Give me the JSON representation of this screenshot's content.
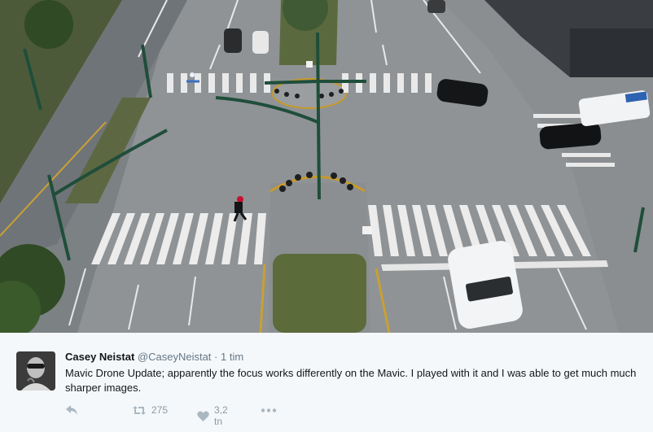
{
  "tweet": {
    "author_name": "Casey Neistat",
    "author_handle": "@CaseyNeistat",
    "separator": "·",
    "time": "1 tim",
    "text": "Mavic Drone Update; apparently the focus works differently on the Mavic.  I played with it and I was able to get much much sharper images.",
    "media_description_icon": "drone-photo-intersection"
  },
  "actions": {
    "reply_icon": "reply-icon",
    "retweet_count": "275",
    "like_count": "3,2 tn",
    "more_icon": "more-icon"
  },
  "colors": {
    "name": "#14171a",
    "meta": "#657786",
    "action": "#8899a6",
    "panel_bg": "#f5f8fa",
    "road": "#8d9194",
    "median_green": "#5b6b3a"
  }
}
